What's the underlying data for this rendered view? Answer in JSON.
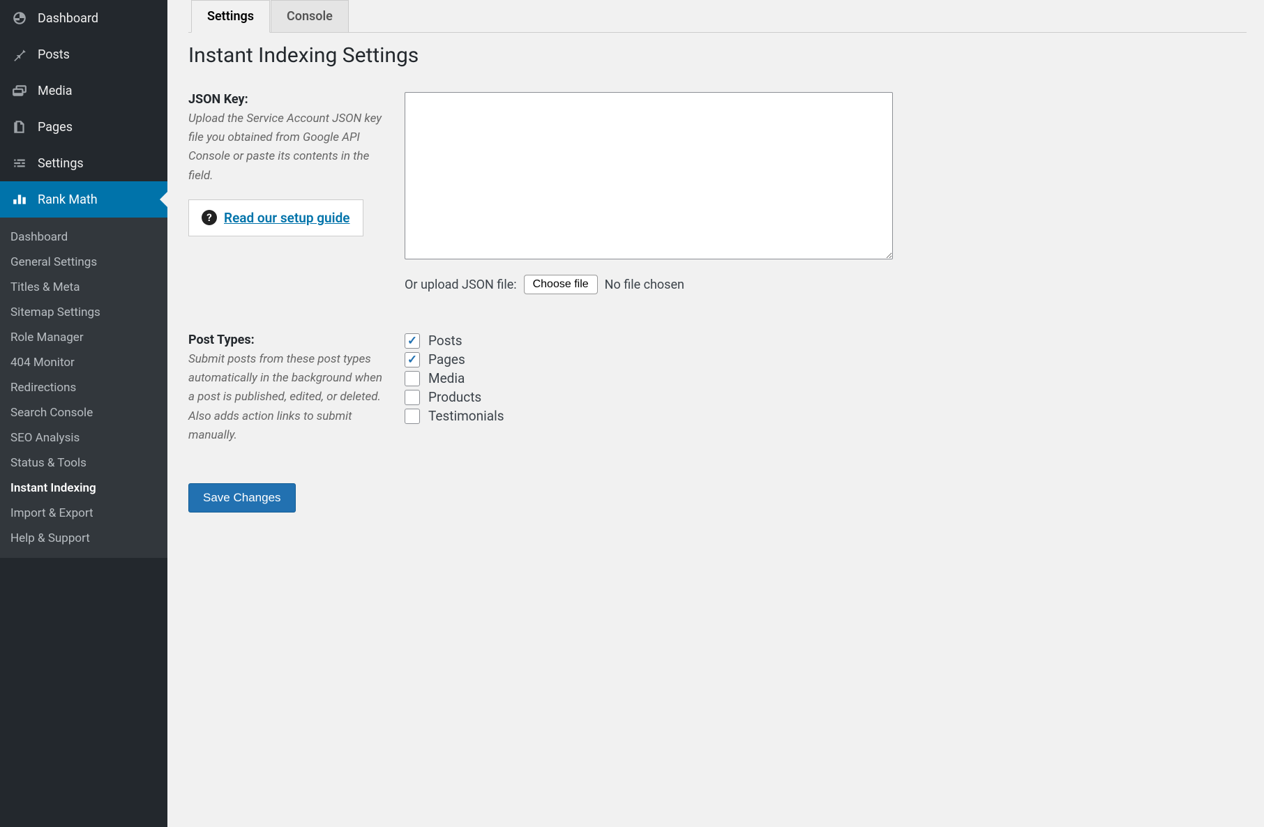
{
  "sidebar": {
    "items": [
      {
        "label": "Dashboard",
        "icon": "dashboard-icon"
      },
      {
        "label": "Posts",
        "icon": "pin-icon"
      },
      {
        "label": "Media",
        "icon": "media-icon"
      },
      {
        "label": "Pages",
        "icon": "pages-icon"
      },
      {
        "label": "Settings",
        "icon": "settings-slider-icon"
      },
      {
        "label": "Rank Math",
        "icon": "chart-icon"
      }
    ],
    "submenu": [
      {
        "label": "Dashboard"
      },
      {
        "label": "General Settings"
      },
      {
        "label": "Titles & Meta"
      },
      {
        "label": "Sitemap Settings"
      },
      {
        "label": "Role Manager"
      },
      {
        "label": "404 Monitor"
      },
      {
        "label": "Redirections"
      },
      {
        "label": "Search Console"
      },
      {
        "label": "SEO Analysis"
      },
      {
        "label": "Status & Tools"
      },
      {
        "label": "Instant Indexing"
      },
      {
        "label": "Import & Export"
      },
      {
        "label": "Help & Support"
      }
    ]
  },
  "tabs": [
    {
      "label": "Settings"
    },
    {
      "label": "Console"
    }
  ],
  "page_title": "Instant Indexing Settings",
  "json_key": {
    "label": "JSON Key:",
    "description": "Upload the Service Account JSON key file you obtained from Google API Console or paste its contents in the field.",
    "guide_link": "Read our setup guide",
    "upload_label": "Or upload JSON file:",
    "choose_file": "Choose file",
    "no_file": "No file chosen",
    "value": ""
  },
  "post_types": {
    "label": "Post Types:",
    "description": "Submit posts from these post types automatically in the background when a post is published, edited, or deleted. Also adds action links to submit manually.",
    "options": [
      {
        "label": "Posts",
        "checked": true
      },
      {
        "label": "Pages",
        "checked": true
      },
      {
        "label": "Media",
        "checked": false
      },
      {
        "label": "Products",
        "checked": false
      },
      {
        "label": "Testimonials",
        "checked": false
      }
    ]
  },
  "save_button": "Save Changes"
}
